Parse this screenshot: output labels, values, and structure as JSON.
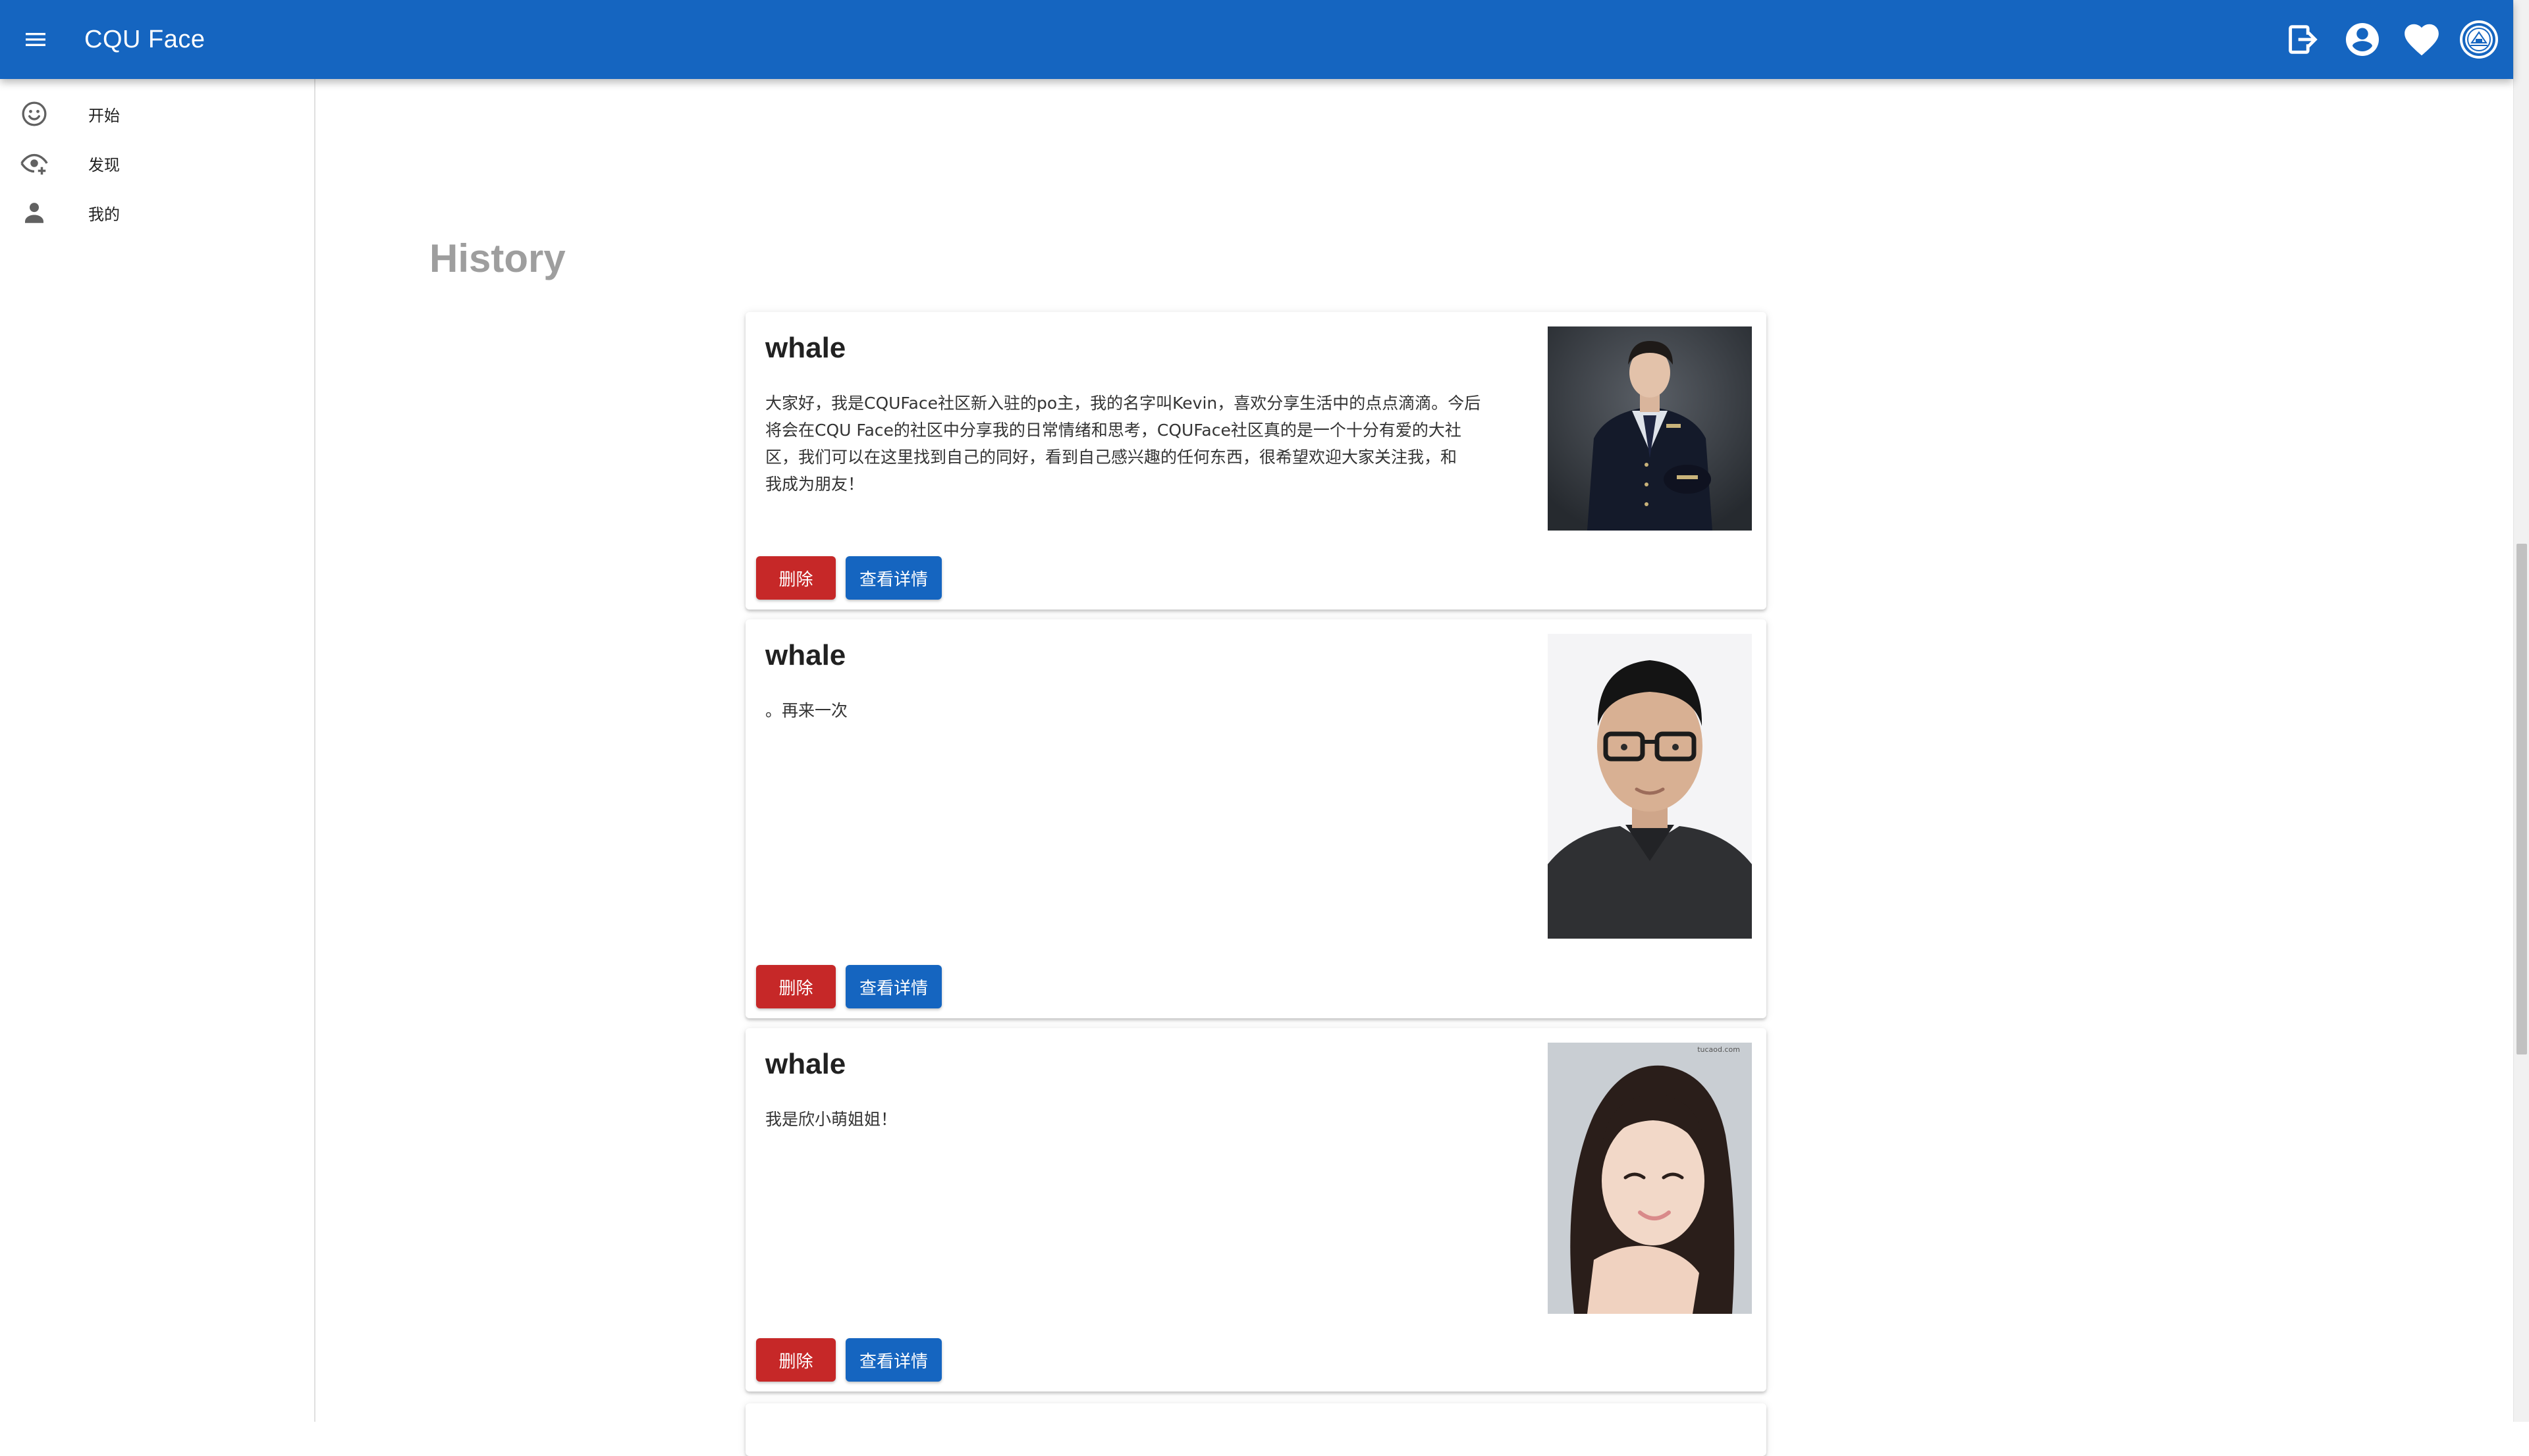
{
  "app": {
    "title": "CQU Face"
  },
  "appbar": {
    "actions": [
      {
        "icon": "logout-icon"
      },
      {
        "icon": "account-circle-icon"
      },
      {
        "icon": "heart-icon"
      },
      {
        "icon": "university-logo-icon"
      }
    ]
  },
  "sidebar": {
    "items": [
      {
        "label": "开始",
        "icon": "smiley-face-icon"
      },
      {
        "label": "发现",
        "icon": "eye-plus-icon"
      },
      {
        "label": "我的",
        "icon": "person-icon"
      }
    ]
  },
  "main": {
    "section_title": "History",
    "posts": [
      {
        "author": "whale",
        "lines": [
          "大家好，我是CQUFace社区新入驻的po主，我的名字叫Kevin，喜欢分享生活中的点点滴滴。今后",
          "将会在CQU Face的社区中分享我的日常情绪和思考，CQUFace社区真的是一个十分有爱的大社",
          "区，我们可以在这里找到自己的同好，看到自己感兴趣的任何东西，很希望欢迎大家关注我，和",
          "我成为朋友！"
        ],
        "photo": "photo-man-in-uniform",
        "delete_label": "删除",
        "detail_label": "查看详情"
      },
      {
        "author": "whale",
        "lines": [
          "。再来一次"
        ],
        "photo": "photo-man-with-glasses",
        "delete_label": "删除",
        "detail_label": "查看详情"
      },
      {
        "author": "whale",
        "lines": [
          "我是欣小萌姐姐！"
        ],
        "photo": "photo-woman-selfie",
        "watermark": "tucaod.com",
        "delete_label": "删除",
        "detail_label": "查看详情"
      }
    ]
  },
  "colors": {
    "primary": "#1565c0",
    "danger": "#c62828",
    "section_title": "#9e9e9e"
  }
}
